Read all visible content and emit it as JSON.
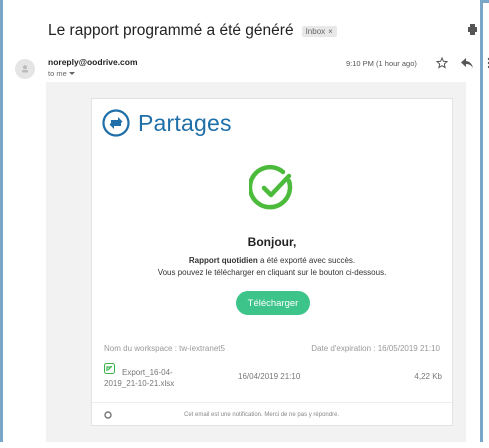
{
  "email": {
    "subject": "Le rapport programmé a été généré",
    "label_chip": "Inbox",
    "label_chip_close": "×",
    "sender": "noreply@oodrive.com",
    "to_line": "to me",
    "time": "9:10 PM (1 hour ago)"
  },
  "message": {
    "brand": "Partages",
    "greeting": "Bonjour,",
    "report_name": "Rapport quotidien",
    "line1_suffix": " a été exporté avec succès.",
    "line2": "Vous pouvez le télécharger en cliquant sur le bouton ci-dessous.",
    "download_button": "Télécharger",
    "workspace": "Nom du workspace : tw-iextranet5",
    "expiration": "Date d'expiration : 16/05/2019 21:10",
    "file": {
      "name": "Export_16-04-2019_21-10-21.xlsx",
      "date": "16/04/2019 21:10",
      "size": "4,22 Kb"
    },
    "footer": "Cet email est une notification. Merci de ne pas y répondre."
  },
  "colors": {
    "brand_blue": "#1f6fa8",
    "success_green": "#3cc48a",
    "check_green": "#4cbb3c"
  }
}
